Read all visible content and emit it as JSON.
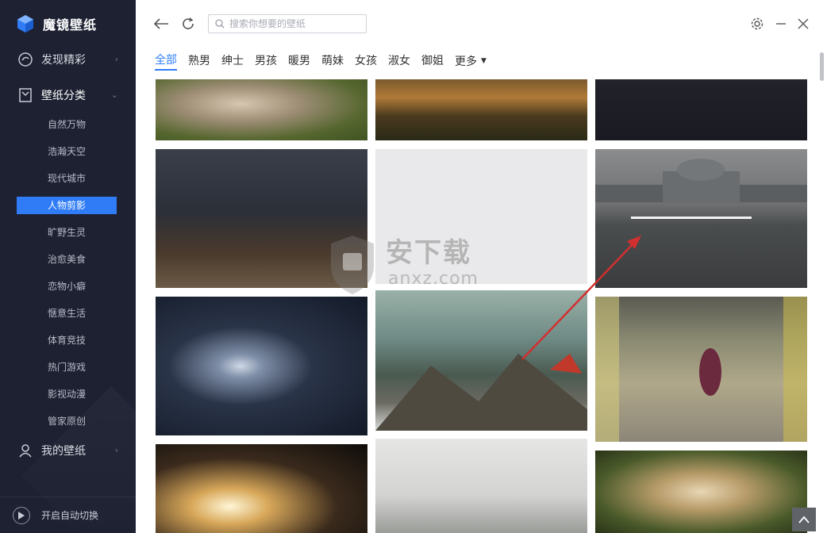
{
  "app": {
    "name": "魔镜壁纸"
  },
  "sidebar": {
    "discover_label": "发现精彩",
    "categories_label": "壁纸分类",
    "sub_items": [
      "自然万物",
      "浩瀚天空",
      "现代城市",
      "人物剪影",
      "旷野生灵",
      "治愈美食",
      "恋物小癖",
      "惬意生活",
      "体育竞技",
      "热门游戏",
      "影视动漫",
      "管家原创"
    ],
    "active_index": 3,
    "my_wallpapers_label": "我的壁纸",
    "auto_switch_label": "开启自动切换"
  },
  "search": {
    "placeholder": "搜索你想要的壁纸"
  },
  "tabs": {
    "items": [
      "全部",
      "熟男",
      "绅士",
      "男孩",
      "暖男",
      "萌妹",
      "女孩",
      "淑女",
      "御姐"
    ],
    "active_index": 0,
    "more_label": "更多"
  },
  "watermark": {
    "main": "安下载",
    "sub": "anxz.com"
  },
  "icons": [
    "app-logo-icon",
    "discover-icon",
    "categories-icon",
    "my-wallpapers-icon",
    "play-icon",
    "back-arrow-icon",
    "refresh-icon",
    "search-icon",
    "settings-icon",
    "minimize-icon",
    "close-icon",
    "caret-down-icon",
    "back-to-top-icon"
  ],
  "colors": {
    "sidebar_bg": "#1d2132",
    "accent": "#2f7cf6",
    "annotation_arrow": "#d32f2f"
  }
}
